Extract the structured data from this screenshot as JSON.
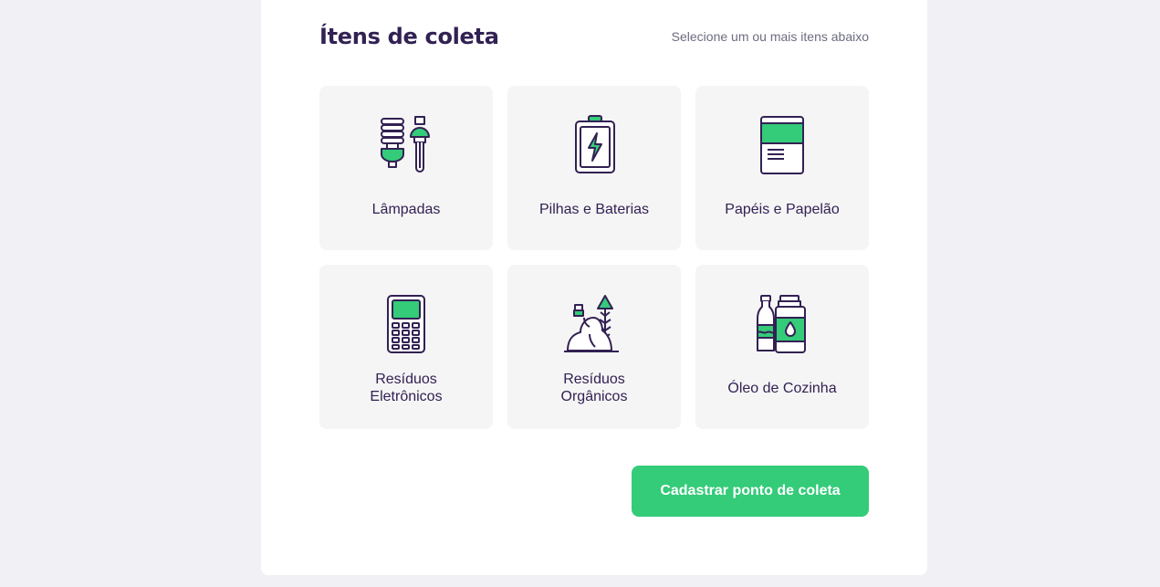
{
  "section": {
    "title": "Ítens de coleta",
    "hint": "Selecione um ou mais itens abaixo"
  },
  "items": [
    {
      "label": "Lâmpadas",
      "icon": "lamps-icon"
    },
    {
      "label": "Pilhas e Baterias",
      "icon": "battery-icon"
    },
    {
      "label": "Papéis e Papelão",
      "icon": "paper-icon"
    },
    {
      "label": "Resíduos\nEletrônicos",
      "icon": "electronics-icon"
    },
    {
      "label": "Resíduos\nOrgânicos",
      "icon": "organic-waste-icon"
    },
    {
      "label": "Óleo de Cozinha",
      "icon": "cooking-oil-icon"
    }
  ],
  "actions": {
    "submit_label": "Cadastrar ponto de coleta"
  },
  "colors": {
    "primary": "#34cb79",
    "title": "#322153",
    "text_muted": "#6c6c80",
    "background": "#f0f0f5",
    "item_background": "#f5f5f5"
  }
}
